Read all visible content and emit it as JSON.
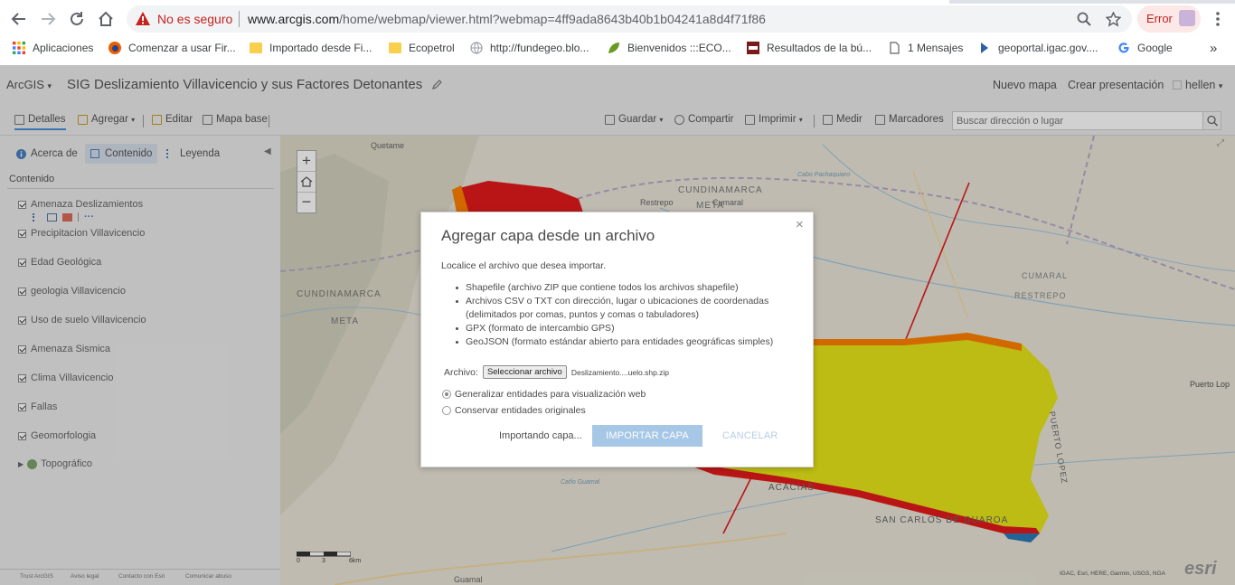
{
  "browser": {
    "security_label": "No es seguro",
    "url_host": "www.arcgis.com",
    "url_path": "/home/webmap/viewer.html?webmap=4ff9ada8643b40b1b04241a8d4f71f86",
    "error_label": "Error"
  },
  "bookmarks": [
    {
      "label": "Aplicaciones",
      "icon": "apps-grid-icon"
    },
    {
      "label": "Comenzar a usar Fir...",
      "icon": "firefox-icon"
    },
    {
      "label": "Importado desde Fi...",
      "icon": "folder-icon"
    },
    {
      "label": "Ecopetrol",
      "icon": "folder-icon"
    },
    {
      "label": "http://fundegeo.blo...",
      "icon": "globe-icon"
    },
    {
      "label": "Bienvenidos :::ECO...",
      "icon": "leaf-icon"
    },
    {
      "label": "Resultados de la bú...",
      "icon": "site-icon"
    },
    {
      "label": "1 Mensajes",
      "icon": "page-icon"
    },
    {
      "label": "geoportal.igac.gov....",
      "icon": "igac-icon"
    },
    {
      "label": "Google",
      "icon": "google-icon"
    }
  ],
  "bookmarks_overflow": "»",
  "app": {
    "logo": "ArcGIS",
    "title": "SIG Deslizamiento Villavicencio y sus Factores Detonantes",
    "new_map": "Nuevo mapa",
    "create_presentation": "Crear presentación",
    "user": "hellen"
  },
  "toolbar": {
    "details": "Detalles",
    "add": "Agregar",
    "edit": "Editar",
    "basemap": "Mapa base",
    "save": "Guardar",
    "share": "Compartir",
    "print": "Imprimir",
    "measure": "Medir",
    "bookmarks": "Marcadores",
    "search_placeholder": "Buscar dirección o lugar"
  },
  "panel": {
    "tabs": [
      "Acerca de",
      "Contenido",
      "Leyenda"
    ],
    "heading": "Contenido",
    "layers": [
      "Amenaza Deslizamientos",
      "Precipitacion Villavicencio",
      "Edad Geológica",
      "geologia Villavicencio",
      "Uso de suelo Villavicencio",
      "Amenaza Sismica",
      "Clima Villavicencio",
      "Fallas",
      "Geomorfologia"
    ],
    "basemap_layer": "Topográfico",
    "footer": [
      "Trust ArcGIS",
      "Aviso legal",
      "Contacto con Esri",
      "Comunicar abuso"
    ]
  },
  "map": {
    "labels": [
      "Quetame",
      "CUNDINAMARCA",
      "META",
      "Restrepo",
      "Cumaral",
      "CUMARAL",
      "RESTREPO",
      "CUNDINAMARCA",
      "META",
      "Puerto Lop",
      "PUERTO LOPEZ",
      "ACACIAS",
      "SAN CARLOS DE GUAROA",
      "Guamal",
      "Cabo Pachaquiaro",
      "Caño Guamal"
    ],
    "scale_ticks": [
      "0",
      "3",
      "6km"
    ],
    "attribution": "IGAC, Esri, HERE, Garmin, USGS, NGA",
    "esri_logo": "esri",
    "colors": {
      "threat_high": "#e31a1c",
      "threat_mid": "#ff7f00",
      "threat_low": "#e6e619",
      "water": "#2b7bb9"
    }
  },
  "dialog": {
    "title": "Agregar capa desde un archivo",
    "close": "×",
    "intro": "Localice el archivo que desea importar.",
    "formats": [
      "Shapefile (archivo ZIP que contiene todos los archivos shapefile)",
      "Archivos CSV o TXT con dirección, lugar o ubicaciones de coordenadas (delimitados por comas, puntos y comas o tabuladores)",
      "GPX (formato de intercambio GPS)",
      "GeoJSON (formato estándar abierto para entidades geográficas simples)"
    ],
    "file_label": "Archivo:",
    "file_button": "Seleccionar archivo",
    "file_name": "Deslizamiento....uelo.shp.zip",
    "option_generalize": "Generalizar entidades para visualización web",
    "option_keep": "Conservar entidades originales",
    "status": "Importando capa...",
    "import_button": "IMPORTAR CAPA",
    "cancel_button": "CANCELAR"
  }
}
